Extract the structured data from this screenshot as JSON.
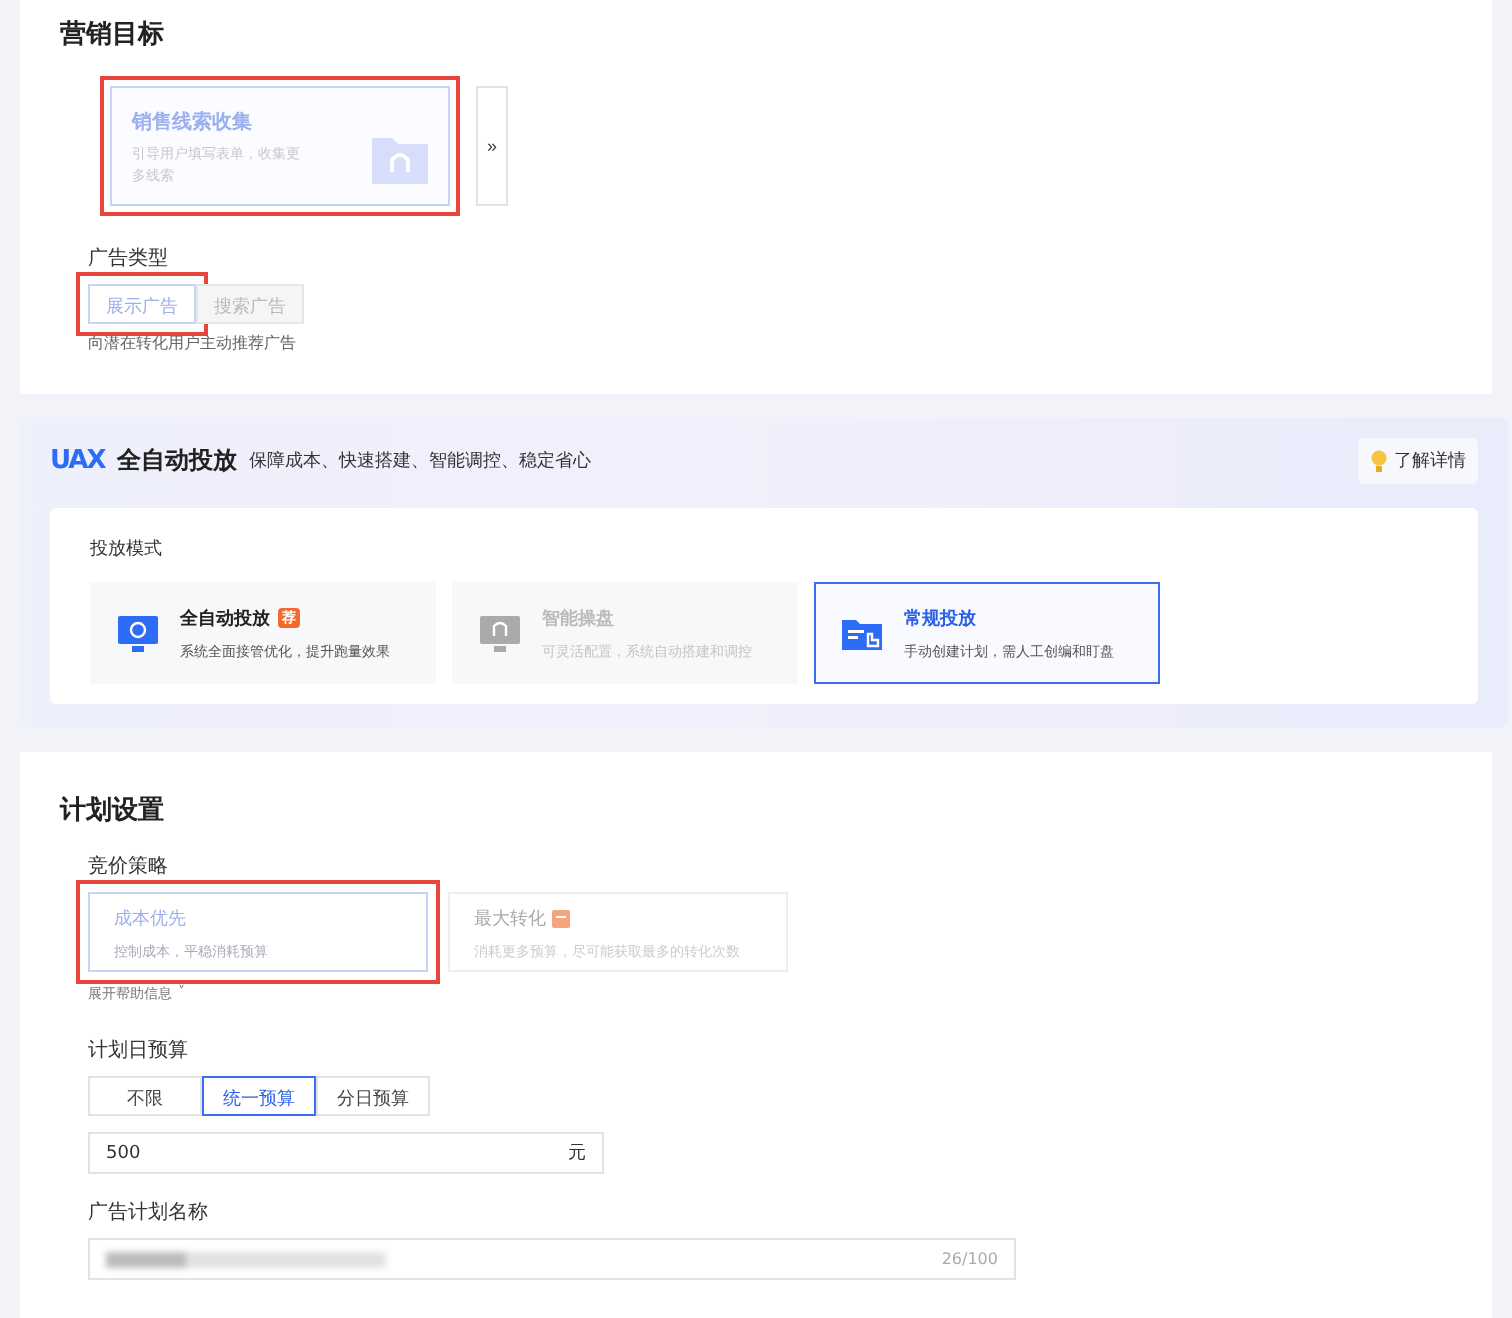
{
  "marketing_goal": {
    "title": "营销目标",
    "goal_card": {
      "title": "销售线索收集",
      "description": "引导用户填写表单，收集更多线索",
      "selected": true,
      "highlighted": true
    },
    "more_button": "»",
    "ad_type": {
      "label": "广告类型",
      "options": [
        {
          "label": "展示广告",
          "selected": true,
          "disabled": false,
          "highlighted": true
        },
        {
          "label": "搜索广告",
          "selected": false,
          "disabled": true,
          "highlighted": false
        }
      ],
      "hint": "向潜在转化用户主动推荐广告"
    }
  },
  "uax_banner": {
    "logo": "UAX",
    "title": "全自动投放",
    "subtitle": "保障成本、快速搭建、智能调控、稳定省心",
    "learn_more": "了解详情",
    "mode_label": "投放模式",
    "modes": [
      {
        "kind": "auto",
        "title": "全自动投放",
        "badge": "荐",
        "description": "系统全面接管优化，提升跑量效果",
        "selected": false,
        "disabled": false
      },
      {
        "kind": "smart",
        "title": "智能操盘",
        "description": "可灵活配置，系统自动搭建和调控",
        "selected": false,
        "disabled": true
      },
      {
        "kind": "manual",
        "title": "常规投放",
        "description": "手动创建计划，需人工创编和盯盘",
        "selected": true,
        "disabled": false
      }
    ]
  },
  "plan_settings": {
    "title": "计划设置",
    "bid_label": "竞价策略",
    "bid_options": [
      {
        "title": "成本优先",
        "description": "控制成本，平稳消耗预算",
        "selected": true,
        "disabled": false,
        "has_badge": false,
        "highlighted": true
      },
      {
        "title": "最大转化",
        "description": "消耗更多预算，尽可能获取最多的转化次数",
        "selected": false,
        "disabled": true,
        "has_badge": true,
        "highlighted": false
      }
    ],
    "help_toggle": "展开帮助信息",
    "help_caret": "˅",
    "budget_label": "计划日预算",
    "budget_options": [
      {
        "label": "不限",
        "selected": false
      },
      {
        "label": "统一预算",
        "selected": true
      },
      {
        "label": "分日预算",
        "selected": false
      }
    ],
    "budget_value": "500",
    "budget_unit": "元",
    "name_label": "广告计划名称",
    "name_counter": "26/100"
  }
}
